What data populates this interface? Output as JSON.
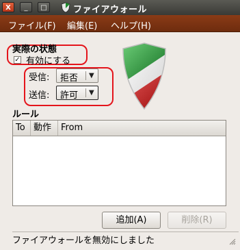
{
  "window": {
    "title": "ファイアウォール",
    "close_glyph": "X",
    "minimize_glyph": "_",
    "maximize_glyph": "□",
    "app_icon": "shield-icon"
  },
  "menubar": {
    "items": [
      {
        "label": "ファイル(F)"
      },
      {
        "label": "編集(E)"
      },
      {
        "label": "ヘルプ(H)"
      }
    ]
  },
  "state": {
    "heading": "実際の状態",
    "enable_label": "有効にする",
    "enabled": true
  },
  "traffic": {
    "incoming_label": "受信:",
    "incoming_value": "拒否",
    "outgoing_label": "送信:",
    "outgoing_value": "許可"
  },
  "rules": {
    "heading": "ルール",
    "columns": [
      "To",
      "動作",
      "From"
    ],
    "rows": []
  },
  "buttons": {
    "add_label": "追加(A)",
    "remove_label": "削除(R)"
  },
  "status": {
    "text": "ファイアウォールを無効にしました"
  },
  "colors": {
    "menubar": "#7a3412",
    "highlight": "#e4141b",
    "shield_green": "#1f8a2e",
    "shield_red": "#c41e1e"
  }
}
